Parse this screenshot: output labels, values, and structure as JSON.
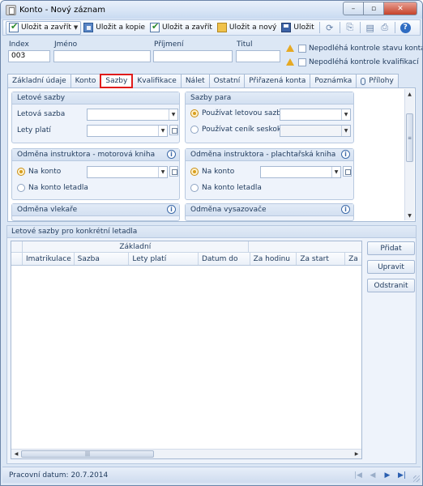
{
  "window": {
    "title": "Konto  - Nový záznam",
    "controls": {
      "minimize": "–",
      "maximize": "▫",
      "close": "✕"
    }
  },
  "toolbar": {
    "save_close": "Uložit a zavřít",
    "save_copy": "Uložit a kopie",
    "save_close2": "Uložit a zavřít",
    "save_new": "Uložit a nový",
    "save": "Uložit",
    "help": "?"
  },
  "header": {
    "index_label": "Index",
    "index_value": "003",
    "name_label": "Jméno",
    "name_value": "",
    "surname_label": "Příjmení",
    "surname_value": "",
    "title_label": "Titul",
    "title_value": "",
    "chk_account_state": "Nepodléhá kontrole stavu konta",
    "chk_qualification": "Nepodléhá kontrole kvalifikací"
  },
  "tabs": [
    {
      "label": "Základní údaje"
    },
    {
      "label": "Konto"
    },
    {
      "label": "Sazby"
    },
    {
      "label": "Kvalifikace"
    },
    {
      "label": "Nálet"
    },
    {
      "label": "Ostatní"
    },
    {
      "label": "Přiřazená konta"
    },
    {
      "label": "Poznámka"
    },
    {
      "label": "Přílohy"
    }
  ],
  "active_tab": "Sazby",
  "groups": {
    "letove_sazby": {
      "title": "Letové sazby",
      "rate_label": "Letová sazba",
      "flights_label": "Lety platí"
    },
    "sazby_para": {
      "title": "Sazby para",
      "opt_rate": "Používat letovou sazbu",
      "opt_price": "Používat ceník seskoků"
    },
    "odmena_motor": {
      "title": "Odměna instruktora - motorová kniha",
      "opt_account": "Na konto",
      "opt_plane_account": "Na konto letadla"
    },
    "odmena_glider": {
      "title": "Odměna instruktora - plachtařská kniha",
      "opt_account": "Na konto",
      "opt_plane_account": "Na konto letadla"
    },
    "odmena_vlekare": {
      "title": "Odměna vlekaře"
    },
    "odmena_vysazovace": {
      "title": "Odměna vysazovače"
    }
  },
  "lower": {
    "title": "Letové sazby pro konkrétní letadla",
    "band": "Základní",
    "columns": [
      "Imatrikulace",
      "Sazba",
      "Lety platí",
      "Datum do",
      "Za hodinu",
      "Za start",
      "Za"
    ],
    "rows": [],
    "buttons": {
      "add": "Přidat",
      "edit": "Upravit",
      "remove": "Odstranit"
    }
  },
  "status": {
    "working_date": "Pracovní datum: 20.7.2014"
  },
  "colors": {
    "frame": "#dce7f5",
    "accent": "#2a5fb0",
    "active_tab_border": "#e01b1b",
    "warning": "#e6a923"
  }
}
